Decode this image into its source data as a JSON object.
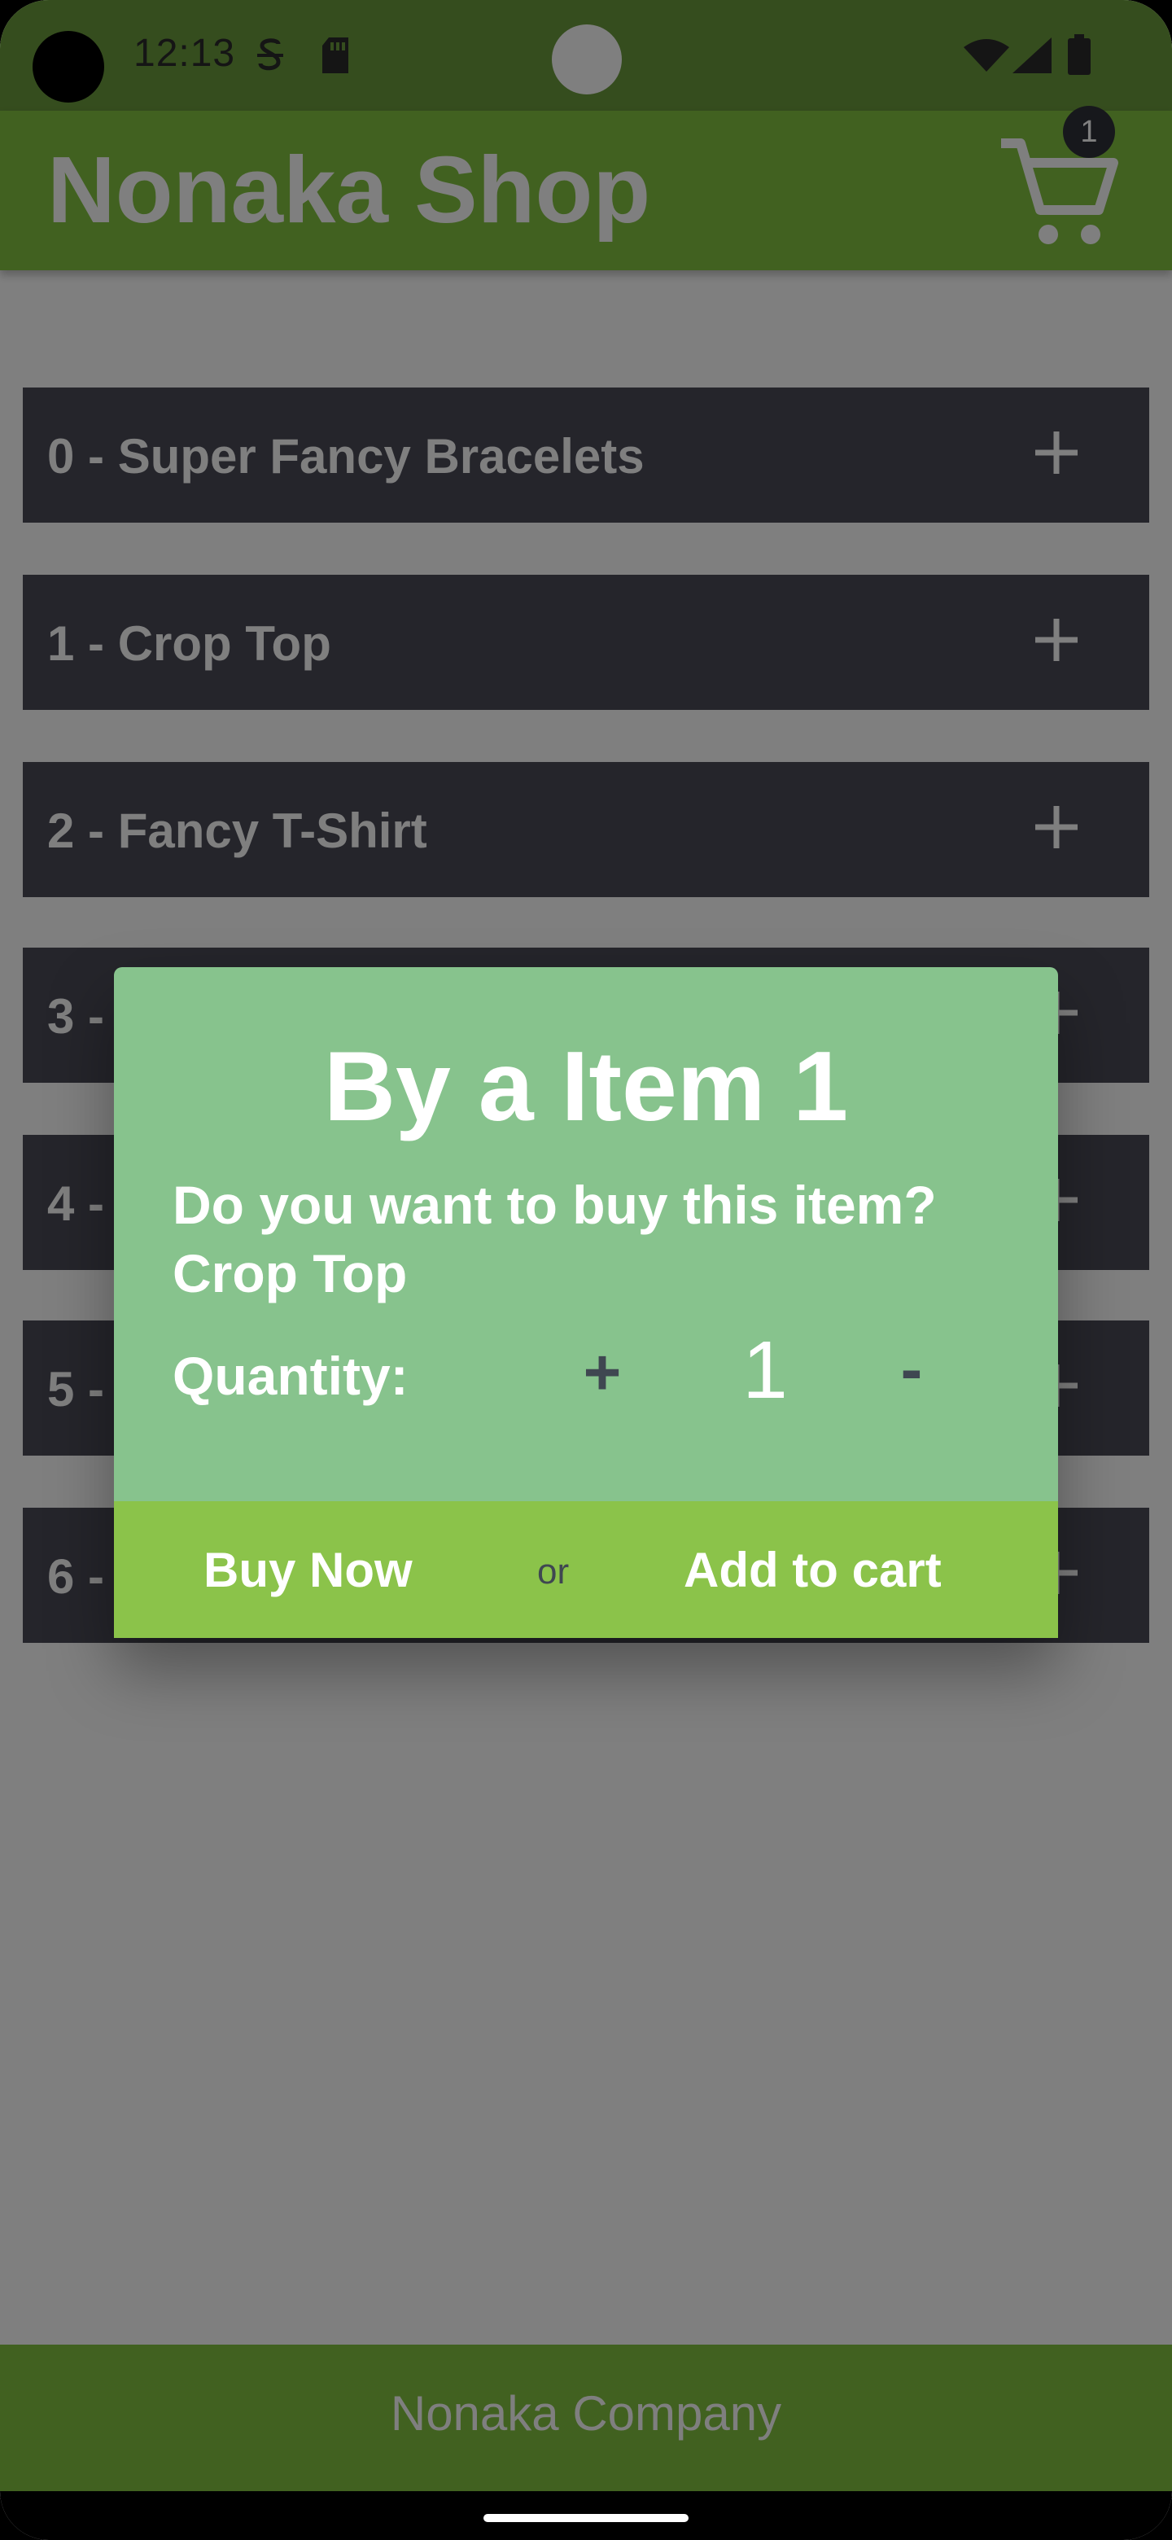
{
  "status_bar": {
    "time": "12:13",
    "icons": [
      "sim-icon",
      "sd-card-icon",
      "wifi-icon",
      "signal-icon",
      "battery-icon"
    ]
  },
  "app_bar": {
    "title": "Nonaka Shop",
    "cart_icon": "cart-icon",
    "cart_count": "1"
  },
  "items": [
    {
      "label": "0 - Super Fancy Bracelets",
      "action_icon": "plus-icon"
    },
    {
      "label": "1 - Crop Top",
      "action_icon": "plus-icon"
    },
    {
      "label": "2 - Fancy T-Shirt",
      "action_icon": "plus-icon"
    },
    {
      "label": "3 -",
      "action_icon": "plus-icon"
    },
    {
      "label": "4 -",
      "action_icon": "plus-icon"
    },
    {
      "label": "5 -",
      "action_icon": "plus-icon"
    },
    {
      "label": "6 -",
      "action_icon": "plus-icon"
    }
  ],
  "dialog": {
    "title": "By a Item 1",
    "question": "Do you want to buy this item?",
    "item_name": "Crop Top",
    "quantity_label": "Quantity:",
    "increment": "+",
    "quantity": "1",
    "decrement": "-",
    "buy_now": "Buy Now",
    "or": "or",
    "add_to_cart": "Add to cart"
  },
  "footer": {
    "text": "Nonaka Company"
  },
  "colors": {
    "primary": "#82c341",
    "dialog_bg": "#87c38d",
    "action_bar": "#8bc34a",
    "list_item": "#4a4b57"
  }
}
